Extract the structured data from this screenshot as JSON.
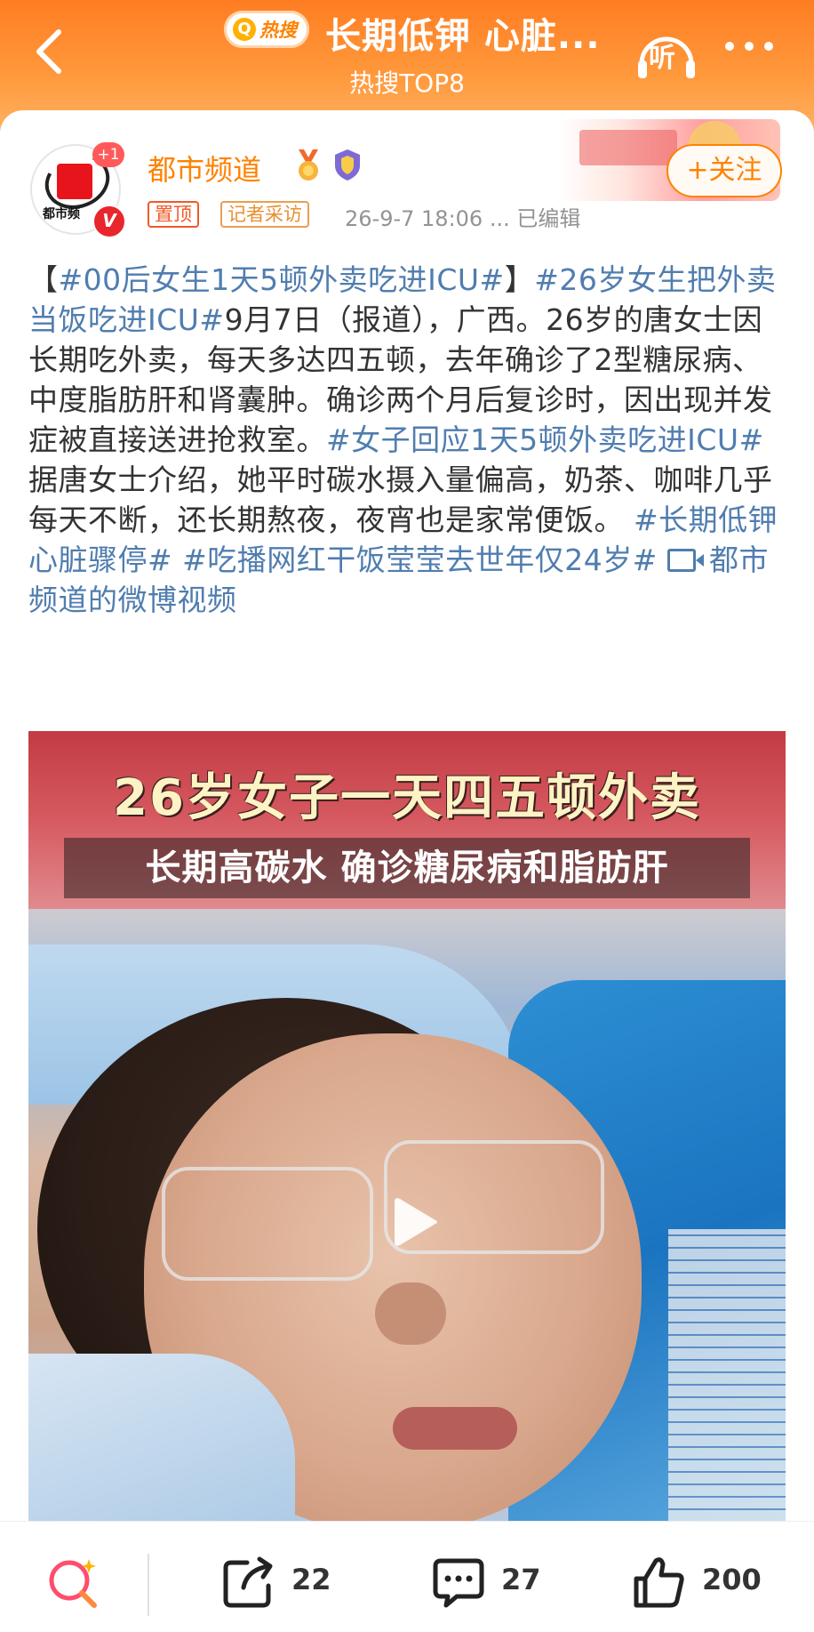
{
  "header": {
    "hot_badge": "热搜",
    "title": "长期低钾 心脏...",
    "subtitle": "热搜TOP8",
    "listen_label": "听"
  },
  "post": {
    "avatar_text": "都市频",
    "plus_badge": "+1",
    "verified_badge": "V",
    "author": "都市频道",
    "follow_label": "+关注",
    "tag_pinned": "置顶",
    "tag_reporter": "记者采访",
    "meta": "26-9-7 18:06   ...   已编辑",
    "text": {
      "p1": "【",
      "tag1": "#00后女生1天5顿外卖吃进ICU#",
      "p2": "】",
      "tag2": "#26岁女生把外卖当饭吃进ICU#",
      "p3": "9月7日（报道），广西。26岁的唐女士因长期吃外卖，每天多达四五顿，去年确诊了2型糖尿病、中度脂肪肝和肾囊肿。确诊两个月后复诊时，因出现并发症被直接送进抢救室。",
      "tag3": "#女子回应1天5顿外卖吃进ICU#",
      "p4": " 据唐女士介绍，她平时碳水摄入量偏高，奶茶、咖啡几乎每天不断，还长期熬夜，夜宵也是家常便饭。 ",
      "tag4": "#长期低钾 心脏骤停#",
      "p5": " ",
      "tag5": "#吃播网红干饭莹莹去世年仅24岁#",
      "p6": " ",
      "video_link": "都市频道的微博视频"
    },
    "video": {
      "headline": "26岁女子一天四五顿外卖",
      "subline": "长期高碳水 确诊糖尿病和脂肪肝"
    }
  },
  "bottom_bar": {
    "repost_count": "22",
    "comment_count": "27",
    "like_count": "200"
  },
  "colors": {
    "header_orange": "#ff7d22",
    "link_blue": "#507daf",
    "brand_orange": "#ff8200"
  },
  "icons": [
    "back-arrow-icon",
    "search-icon",
    "headphones-icon",
    "more-icon",
    "medal-icon",
    "shield-icon",
    "video-icon",
    "play-icon",
    "repost-icon",
    "comment-icon",
    "like-icon"
  ]
}
